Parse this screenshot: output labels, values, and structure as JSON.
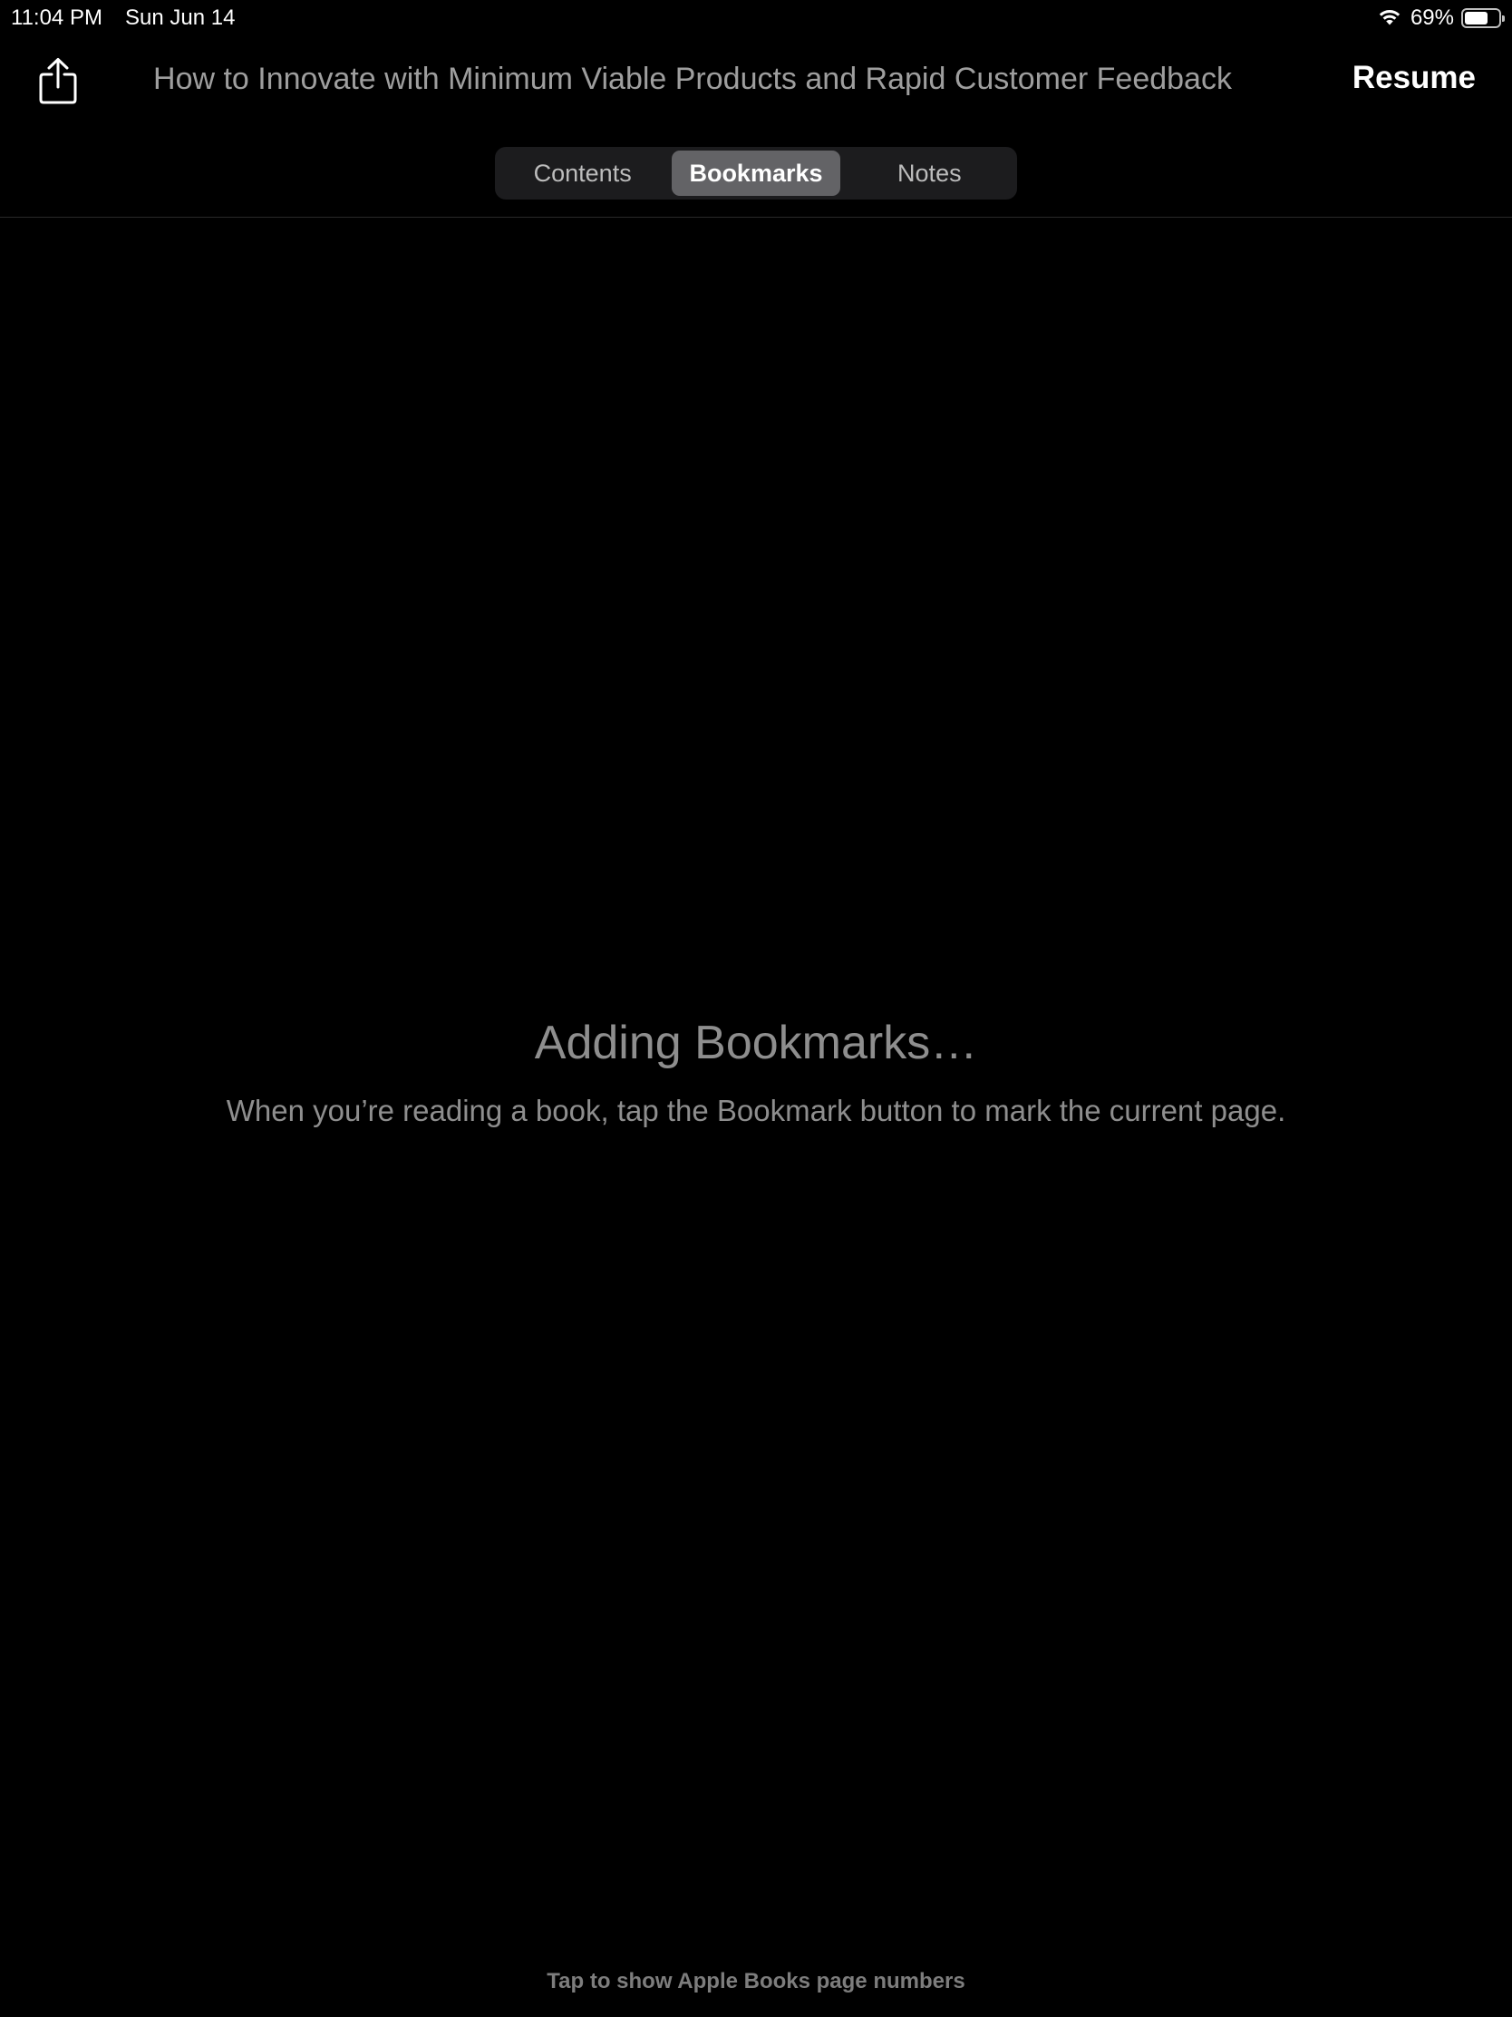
{
  "status_bar": {
    "time": "11:04 PM",
    "date": "Sun Jun 14",
    "battery_percent": "69%",
    "battery_level": 0.69,
    "icons": [
      "wifi-icon",
      "battery-icon"
    ]
  },
  "header": {
    "share_icon": "share-icon",
    "title": "How to Innovate with Minimum Viable Products and Rapid Customer Feedback",
    "resume_label": "Resume"
  },
  "tabs": [
    {
      "label": "Contents",
      "active": false
    },
    {
      "label": "Bookmarks",
      "active": true
    },
    {
      "label": "Notes",
      "active": false
    }
  ],
  "empty_state": {
    "title": "Adding Bookmarks…",
    "message": "When you’re reading a book, tap the Bookmark button to mark the current page."
  },
  "footer": {
    "hint": "Tap to show Apple Books page numbers"
  },
  "colors": {
    "background": "#000000",
    "segment_active": "#636366",
    "segment_track": "#1c1c1e",
    "muted_text": "#8e8e8e"
  }
}
